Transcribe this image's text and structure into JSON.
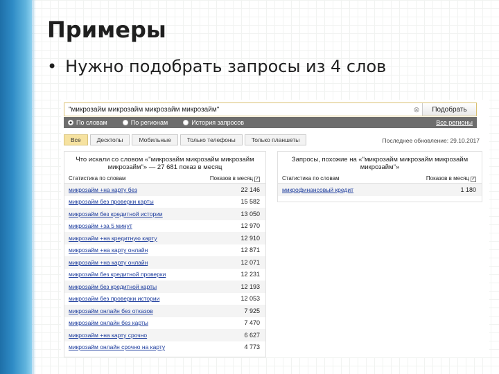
{
  "slide": {
    "title": "Примеры",
    "bullet_marker": "•",
    "bullet": "Нужно подобрать запросы из 4 слов"
  },
  "search": {
    "query": "\"микрозайм микрозайм микрозайм микрозайм\"",
    "clear_symbol": "⊗",
    "button_label": "Подобрать"
  },
  "modes": {
    "options": [
      "По словам",
      "По регионам",
      "История запросов"
    ],
    "selected": "По словам",
    "regions_link": "Все регионы"
  },
  "tabs": {
    "items": [
      "Все",
      "Десктопы",
      "Мобильные",
      "Только телефоны",
      "Только планшеты"
    ],
    "active": "Все"
  },
  "updated_text": "Последнее обновление: 29.10.2017",
  "left_panel": {
    "heading": "Что искали со словом «\"микрозайм микрозайм микрозайм микрозайм\"» — 27 681 показ в месяц",
    "col_words": "Статистика по словам",
    "col_shows": "Показов в месяц",
    "checkbox_mark": "✓",
    "rows": [
      {
        "query": "микрозайм +на карту без",
        "shows": "22 146"
      },
      {
        "query": "микрозайм без проверки карты",
        "shows": "15 582"
      },
      {
        "query": "микрозайм без кредитной истории",
        "shows": "13 050"
      },
      {
        "query": "микрозайм +за 5 минут",
        "shows": "12 970"
      },
      {
        "query": "микрозайм +на кредитную карту",
        "shows": "12 910"
      },
      {
        "query": "микрозайм +на карту онлайн",
        "shows": "12 871"
      },
      {
        "query": "микрозайм +на карту онлайн",
        "shows": "12 071"
      },
      {
        "query": "микрозайм без кредитной проверки",
        "shows": "12 231"
      },
      {
        "query": "микрозайм без кредитной карты",
        "shows": "12 193"
      },
      {
        "query": "микрозайм без проверки истории",
        "shows": "12 053"
      },
      {
        "query": "микрозайм онлайн без отказов",
        "shows": "7 925"
      },
      {
        "query": "микрозайм онлайн без карты",
        "shows": "7 470"
      },
      {
        "query": "микрозайм +на карту срочно",
        "shows": "6 627"
      },
      {
        "query": "микрозайм онлайн срочно на карту",
        "shows": "4 773"
      }
    ]
  },
  "right_panel": {
    "heading": "Запросы, похожие на «\"микрозайм микрозайм микрозайм микрозайм\"»",
    "col_words": "Статистика по словам",
    "col_shows": "Показов в месяц",
    "checkbox_mark": "✓",
    "rows": [
      {
        "query": "микрофинансовый кредит",
        "shows": "1 180"
      }
    ]
  }
}
